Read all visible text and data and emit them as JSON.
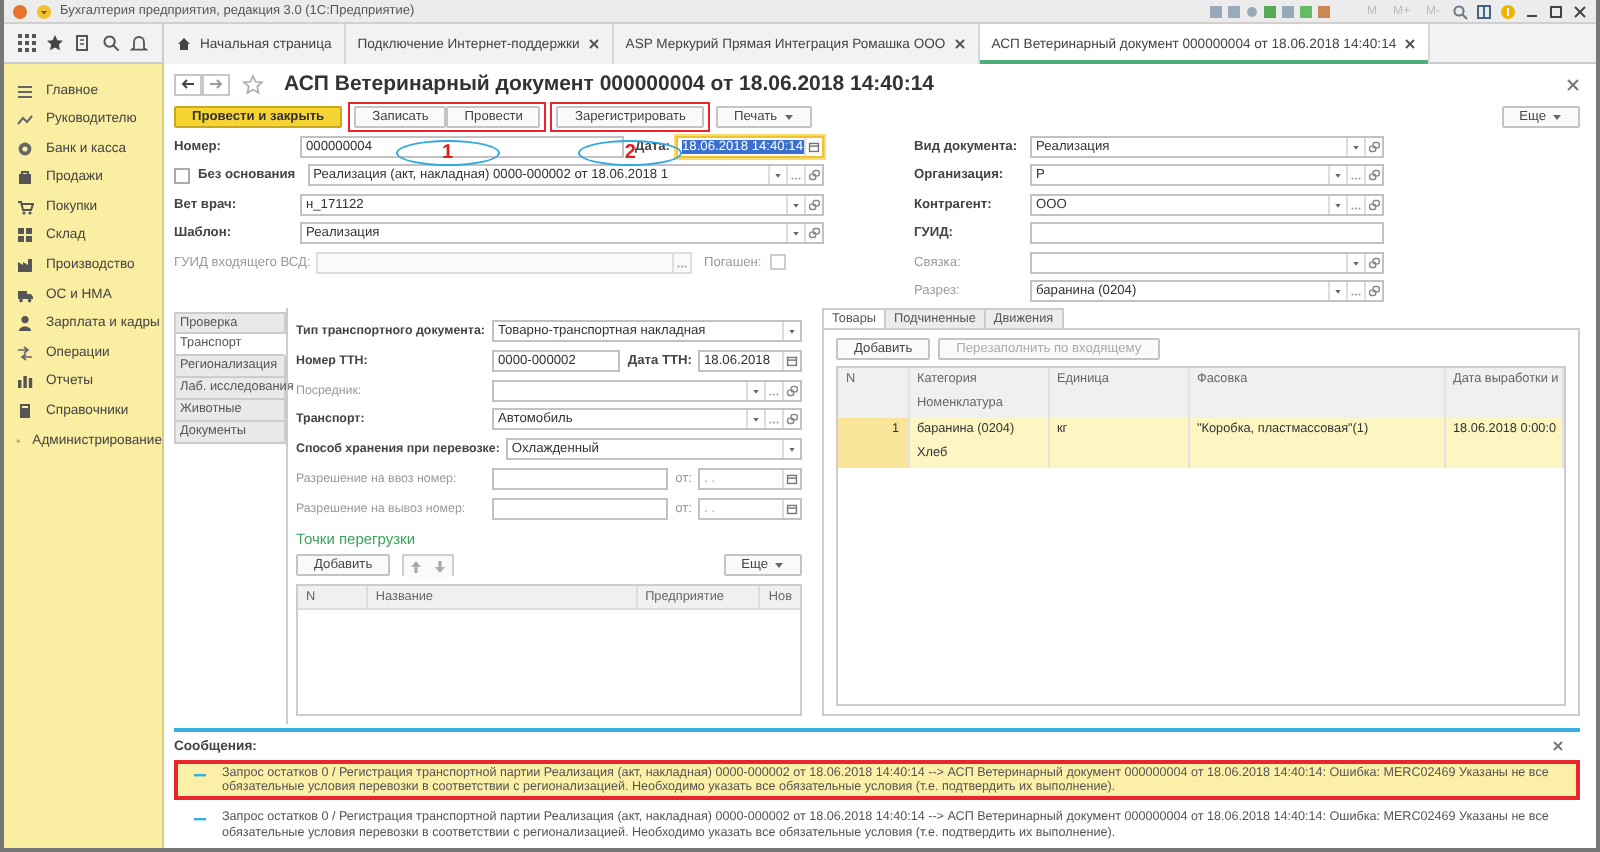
{
  "app_title": "Бухгалтерия предприятия, редакция 3.0 (1С:Предприятие)",
  "memory_buttons": [
    "M",
    "M+",
    "M-"
  ],
  "tabs": [
    {
      "label": "Начальная страница",
      "selected": false,
      "kind": "home"
    },
    {
      "label": "Подключение Интернет-поддержки",
      "selected": false,
      "kind": "closable"
    },
    {
      "label": "ASP Меркурий Прямая Интеграция Ромашка ООО",
      "selected": false,
      "kind": "closable"
    },
    {
      "label": "АСП Ветеринарный документ 000000004 от 18.06.2018 14:40:14",
      "selected": true,
      "kind": "closable"
    }
  ],
  "sidebar": {
    "items": [
      {
        "label": "Главное",
        "kind": "menu"
      },
      {
        "label": "Руководителю",
        "kind": "trend"
      },
      {
        "label": "Банк и касса",
        "kind": "coin"
      },
      {
        "label": "Продажи",
        "kind": "bag"
      },
      {
        "label": "Покупки",
        "kind": "cart"
      },
      {
        "label": "Склад",
        "kind": "grid"
      },
      {
        "label": "Производство",
        "kind": "factory"
      },
      {
        "label": "ОС и НМА",
        "kind": "truck"
      },
      {
        "label": "Зарплата и кадры",
        "kind": "person"
      },
      {
        "label": "Операции",
        "kind": "ops"
      },
      {
        "label": "Отчеты",
        "kind": "bars"
      },
      {
        "label": "Справочники",
        "kind": "book"
      },
      {
        "label": "Администрирование",
        "kind": "gear"
      }
    ]
  },
  "form": {
    "title": "АСП Ветеринарный документ 000000004 от 18.06.2018 14:40:14",
    "toolbar": {
      "groups": [
        {
          "framed": false,
          "buttons": [
            {
              "label": "Провести и закрыть",
              "kind": "primary"
            }
          ]
        },
        {
          "framed": true,
          "callout": "1",
          "buttons": [
            {
              "label": "Записать",
              "kind": "normal"
            },
            {
              "label": "Провести",
              "kind": "normal"
            }
          ]
        },
        {
          "framed": true,
          "callout": "2",
          "buttons": [
            {
              "label": "Зарегистрировать",
              "kind": "normal"
            }
          ]
        },
        {
          "framed": false,
          "buttons": [
            {
              "label": "Печать",
              "kind": "menu"
            }
          ]
        }
      ],
      "more": "Еще"
    },
    "left_rows": [
      {
        "items": [
          {
            "kind": "text",
            "label": "Номер:",
            "bold": true,
            "value": "000000004"
          },
          {
            "kind": "date",
            "label": "Дата:",
            "bold": true,
            "value": "18.06.2018 14:40:14",
            "focused": true,
            "controls": [
              {
                "kind": "calendar"
              }
            ]
          }
        ]
      },
      {
        "items": [
          {
            "kind": "check",
            "label": "Без основания",
            "bold": true,
            "checked": false
          },
          {
            "kind": "text",
            "value": "Реализация (акт, накладная) 0000-000002 от 18.06.2018 1",
            "controls": [
              {
                "kind": "dropdown"
              },
              {
                "kind": "choose"
              },
              {
                "kind": "open"
              }
            ]
          }
        ]
      },
      {
        "items": [
          {
            "kind": "text",
            "label": "Вет врач:",
            "bold": true,
            "value": "н_171122",
            "controls": [
              {
                "kind": "dropdown"
              },
              {
                "kind": "open"
              }
            ]
          }
        ]
      },
      {
        "items": [
          {
            "kind": "text",
            "label": "Шаблон:",
            "bold": true,
            "value": "Реализация",
            "controls": [
              {
                "kind": "dropdown"
              },
              {
                "kind": "open"
              }
            ]
          }
        ]
      },
      {
        "items": [
          {
            "kind": "text",
            "label": "ГУИД входящего ВСД:",
            "bold": false,
            "disabled": true,
            "controls": [
              {
                "kind": "choose"
              }
            ]
          },
          {
            "kind": "check_after",
            "label": "Погашен:",
            "bold": false,
            "checked": false,
            "disabled": true
          }
        ]
      }
    ],
    "right_rows": [
      {
        "items": [
          {
            "kind": "text",
            "label": "Вид документа:",
            "bold": true,
            "value": "Реализация",
            "controls": [
              {
                "kind": "dropdown"
              },
              {
                "kind": "open"
              }
            ]
          }
        ]
      },
      {
        "items": [
          {
            "kind": "text",
            "label": "Организация:",
            "bold": true,
            "value": "Р",
            "controls": [
              {
                "kind": "dropdown"
              },
              {
                "kind": "choose"
              },
              {
                "kind": "open"
              }
            ]
          }
        ]
      },
      {
        "items": [
          {
            "kind": "text",
            "label": "Контрагент:",
            "bold": true,
            "value": "ООО",
            "controls": [
              {
                "kind": "dropdown"
              },
              {
                "kind": "choose"
              },
              {
                "kind": "open"
              }
            ]
          }
        ]
      },
      {
        "items": [
          {
            "kind": "text",
            "label": "ГУИД:",
            "bold": true
          }
        ]
      },
      {
        "items": [
          {
            "kind": "text",
            "label": "Связка:",
            "bold": false,
            "controls": [
              {
                "kind": "dropdown"
              },
              {
                "kind": "open"
              }
            ]
          }
        ]
      },
      {
        "items": [
          {
            "kind": "text",
            "label": "Разрез:",
            "bold": false,
            "value": "баранина (0204)",
            "controls": [
              {
                "kind": "dropdown"
              },
              {
                "kind": "choose"
              },
              {
                "kind": "open"
              }
            ]
          }
        ]
      }
    ],
    "side_tabs": [
      {
        "label": "Проверка",
        "selected": false
      },
      {
        "label": "Транспорт",
        "selected": true
      },
      {
        "label": "Регионализация",
        "selected": false
      },
      {
        "label": "Лаб. исследования",
        "selected": false
      },
      {
        "label": "Животные",
        "selected": false
      },
      {
        "label": "Документы",
        "selected": false
      }
    ],
    "transport_rows": [
      {
        "items": [
          {
            "kind": "text",
            "label": "Тип транспортного документа:",
            "bold": true,
            "value": "Товарно-транспортная накладная",
            "controls": [
              {
                "kind": "dropdown"
              }
            ]
          }
        ]
      },
      {
        "items": [
          {
            "kind": "text",
            "label": "Номер ТТН:",
            "bold": true,
            "value": "0000-000002"
          },
          {
            "kind": "date",
            "label": "Дата ТТН:",
            "bold": true,
            "value": "18.06.2018",
            "focused": false,
            "controls": [
              {
                "kind": "calendar"
              }
            ]
          }
        ]
      },
      {
        "items": [
          {
            "kind": "text",
            "label": "Посредник:",
            "bold": false,
            "controls": [
              {
                "kind": "dropdown"
              },
              {
                "kind": "choose"
              },
              {
                "kind": "open"
              }
            ]
          }
        ]
      },
      {
        "items": [
          {
            "kind": "text",
            "label": "Транспорт:",
            "bold": true,
            "value": "Автомобиль",
            "controls": [
              {
                "kind": "dropdown"
              },
              {
                "kind": "choose"
              },
              {
                "kind": "open"
              }
            ]
          }
        ]
      },
      {
        "items": [
          {
            "kind": "text",
            "label": "Способ хранения при перевозке:",
            "bold": true,
            "value": "Охлажденный",
            "controls": [
              {
                "kind": "dropdown"
              }
            ]
          }
        ]
      },
      {
        "items": [
          {
            "kind": "text",
            "label": "Разрешение на ввоз номер:",
            "bold": false
          },
          {
            "kind": "date",
            "label": "от:",
            "bold": false,
            "placeholder": ". .",
            "focused": false,
            "controls": [
              {
                "kind": "calendar"
              }
            ]
          }
        ]
      },
      {
        "items": [
          {
            "kind": "text",
            "label": "Разрешение на вывоз номер:",
            "bold": false
          },
          {
            "kind": "date",
            "label": "от:",
            "bold": false,
            "placeholder": ". .",
            "focused": false,
            "controls": [
              {
                "kind": "calendar"
              }
            ]
          }
        ]
      }
    ],
    "transfer_points": {
      "title": "Точки перегрузки",
      "buttons": [
        {
          "label": "Добавить",
          "kind": "normal"
        },
        {
          "kind": "up"
        },
        {
          "kind": "down"
        }
      ],
      "more": "Еще",
      "columns": [
        "N",
        "Название",
        "Предприятие",
        "Нов"
      ]
    },
    "goods": {
      "tabs": [
        {
          "label": "Товары",
          "selected": true
        },
        {
          "label": "Подчиненные",
          "selected": false
        },
        {
          "label": "Движения",
          "selected": false
        }
      ],
      "buttons": [
        {
          "label": "Добавить",
          "disabled": false
        },
        {
          "label": "Перезаполнить по входящему",
          "disabled": true
        }
      ],
      "columns": [
        {
          "label": "N"
        },
        {
          "label": "Категория",
          "sublabel": "Номенклатура"
        },
        {
          "label": "Единица"
        },
        {
          "label": "Фасовка"
        },
        {
          "label": "Дата выработки и"
        }
      ],
      "rows": [
        {
          "selected": true,
          "cells": [
            [
              "1"
            ],
            [
              "баранина (0204)",
              "Хлеб"
            ],
            [
              "кг"
            ],
            [
              "\"Коробка, пластмассовая\"(1)"
            ],
            [
              "18.06.2018 0:00:0"
            ]
          ]
        }
      ]
    }
  },
  "messages": {
    "title": "Сообщения:",
    "items": [
      {
        "text": "Запрос остатков 0 / Регистрация транспортной партии Реализация (акт, накладная) 0000-000002 от 18.06.2018 14:40:14 --> АСП Ветеринарный документ 000000004 от 18.06.2018 14:40:14: Ошибка: MERC02469 Указаны не все обязательные условия перевозки в соответствии с регионализацией. Необходимо указать все обязательные условия (т.е. подтвердить их выполнение).",
        "selected": true,
        "framed": true
      },
      {
        "text": "Запрос остатков 0 / Регистрация транспортной партии Реализация (акт, накладная) 0000-000002 от 18.06.2018 14:40:14 --> АСП Ветеринарный документ 000000004 от 18.06.2018 14:40:14: Ошибка: MERC02469 Указаны не все обязательные условия перевозки в соответствии с регионализацией. Необходимо указать все обязательные условия (т.е. подтвердить их выполнение).",
        "selected": false,
        "framed": false
      }
    ]
  }
}
